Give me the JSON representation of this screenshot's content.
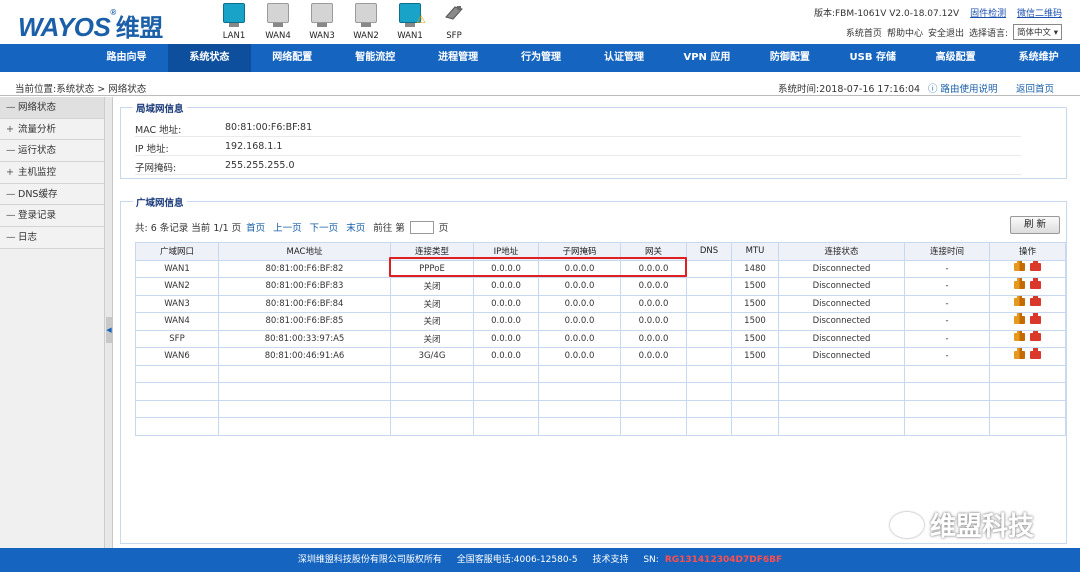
{
  "header": {
    "logo_text": "WAYOS",
    "logo_reg": "®",
    "logo_cn": "维盟",
    "version_label": "版本:FBM-1061V V2.0-18.07.12V",
    "firmware_check": "固件检测",
    "wechat_qr": "微信二维码",
    "links": [
      "系统首页",
      "帮助中心",
      "安全退出"
    ],
    "lang_label": "选择语言:",
    "lang_value": "简体中文 ▾",
    "ports": [
      {
        "label": "LAN1",
        "state": "on",
        "warn": false
      },
      {
        "label": "WAN4",
        "state": "off",
        "warn": false
      },
      {
        "label": "WAN3",
        "state": "off",
        "warn": false
      },
      {
        "label": "WAN2",
        "state": "off",
        "warn": false
      },
      {
        "label": "WAN1",
        "state": "on",
        "warn": true
      },
      {
        "label": "SFP",
        "state": "sfp",
        "warn": false
      }
    ]
  },
  "nav": {
    "items": [
      "路由向导",
      "系统状态",
      "网络配置",
      "智能流控",
      "进程管理",
      "行为管理",
      "认证管理",
      "VPN 应用",
      "防御配置",
      "USB 存储",
      "高级配置",
      "系统维护"
    ],
    "active_index": 1
  },
  "breadcrumb": {
    "text": "当前位置:系统状态 > 网络状态",
    "systime": "系统时间:2018-07-16 17:16:04",
    "help": "路由使用说明",
    "home": "返回首页"
  },
  "sidebar": {
    "items": [
      {
        "sign": "—",
        "label": "网络状态"
      },
      {
        "sign": "+",
        "label": "流量分析"
      },
      {
        "sign": "—",
        "label": "运行状态"
      },
      {
        "sign": "+",
        "label": "主机监控"
      },
      {
        "sign": "—",
        "label": "DNS缓存"
      },
      {
        "sign": "—",
        "label": "登录记录"
      },
      {
        "sign": "—",
        "label": "日志"
      }
    ]
  },
  "lan": {
    "title": "局域网信息",
    "rows": [
      {
        "key": "MAC 地址:",
        "value": "80:81:00:F6:BF:81"
      },
      {
        "key": "IP 地址:",
        "value": "192.168.1.1"
      },
      {
        "key": "子网掩码:",
        "value": "255.255.255.0"
      }
    ]
  },
  "wan": {
    "title": "广域网信息",
    "pager": {
      "summary": "共: 6 条记录 当前 1/1 页",
      "first": "首页",
      "prev": "上一页",
      "next": "下一页",
      "last": "末页",
      "goto": "前往 第",
      "page_unit": "页"
    },
    "refresh": "刷 新",
    "columns": [
      "广域网口",
      "MAC地址",
      "连接类型",
      "IP地址",
      "子网掩码",
      "网关",
      "DNS",
      "MTU",
      "连接状态",
      "连接时间",
      "操作"
    ],
    "rows": [
      [
        "WAN1",
        "80:81:00:F6:BF:82",
        "PPPoE",
        "0.0.0.0",
        "0.0.0.0",
        "0.0.0.0",
        "",
        "1480",
        "Disconnected",
        "-"
      ],
      [
        "WAN2",
        "80:81:00:F6:BF:83",
        "关闭",
        "0.0.0.0",
        "0.0.0.0",
        "0.0.0.0",
        "",
        "1500",
        "Disconnected",
        "-"
      ],
      [
        "WAN3",
        "80:81:00:F6:BF:84",
        "关闭",
        "0.0.0.0",
        "0.0.0.0",
        "0.0.0.0",
        "",
        "1500",
        "Disconnected",
        "-"
      ],
      [
        "WAN4",
        "80:81:00:F6:BF:85",
        "关闭",
        "0.0.0.0",
        "0.0.0.0",
        "0.0.0.0",
        "",
        "1500",
        "Disconnected",
        "-"
      ],
      [
        "SFP",
        "80:81:00:33:97:A5",
        "关闭",
        "0.0.0.0",
        "0.0.0.0",
        "0.0.0.0",
        "",
        "1500",
        "Disconnected",
        "-"
      ],
      [
        "WAN6",
        "80:81:00:46:91:A6",
        "3G/4G",
        "0.0.0.0",
        "0.0.0.0",
        "0.0.0.0",
        "",
        "1500",
        "Disconnected",
        "-"
      ]
    ],
    "empty_rows": 4
  },
  "watermark": "维盟科技",
  "footer": {
    "company": "深圳维盟科技股份有限公司版权所有",
    "hotline": "全国客服电话:4006-12580-5",
    "support": "技术支持",
    "sn_label": "SN:",
    "sn_value": "RG131412304D7DF6BF"
  }
}
